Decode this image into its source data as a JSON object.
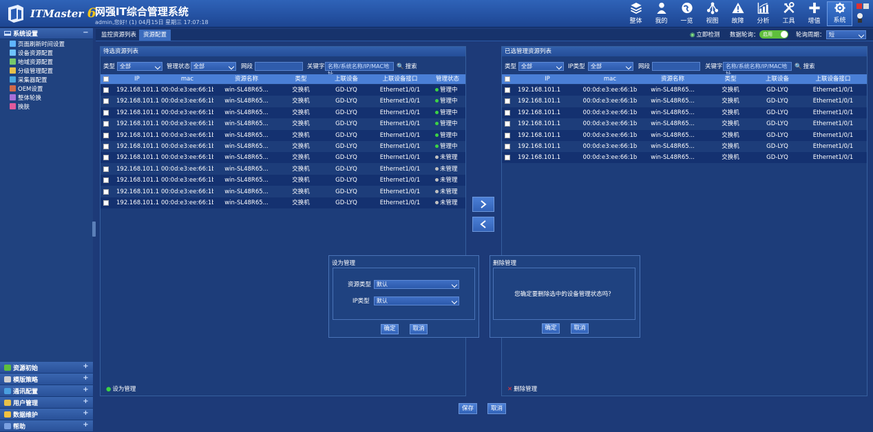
{
  "app": {
    "logo_text": "ITMaster",
    "logo_num": "6",
    "title": "网强IT综合管理系统",
    "subtitle": "admin,您好! (1) 04月15日 星期三 17:07:18"
  },
  "nav": [
    {
      "label": "整体",
      "icon": "layers-icon"
    },
    {
      "label": "我的",
      "icon": "user-icon"
    },
    {
      "label": "一览",
      "icon": "globe-icon"
    },
    {
      "label": "视图",
      "icon": "topology-icon"
    },
    {
      "label": "故障",
      "icon": "warning-icon"
    },
    {
      "label": "分析",
      "icon": "chart-icon"
    },
    {
      "label": "工具",
      "icon": "tools-icon"
    },
    {
      "label": "增值",
      "icon": "plus-icon"
    },
    {
      "label": "系统",
      "icon": "gear-icon"
    }
  ],
  "sidebar": {
    "section": "系统设置",
    "items": [
      "页面刷新时间设置",
      "设备资源配置",
      "地域资源配置",
      "分级管理配置",
      "采集器配置",
      "OEM设置",
      "整体轮换",
      "换肤"
    ],
    "bottom": [
      "资源初始",
      "模版策略",
      "通讯配置",
      "用户管理",
      "数据维护",
      "帮助"
    ]
  },
  "tabs": [
    "监控资源列表",
    "资源配置"
  ],
  "toolbar": {
    "detect": "立即检测",
    "polling_label": "数据轮询：",
    "polling_state": "启用",
    "cycle_label": "轮询周期：",
    "cycle_value": "短"
  },
  "left": {
    "title": "待选资源列表",
    "type_label": "类型",
    "type_value": "全部",
    "status_label": "管理状态",
    "status_value": "全部",
    "segment_label": "网段",
    "keyword_label": "关键字",
    "keyword_placeholder": "名称/系统名称/IP/MAC地址",
    "search": "搜索",
    "columns": [
      "IP",
      "mac",
      "资源名称",
      "类型",
      "上联设备",
      "上联设备接口",
      "管理状态"
    ],
    "rows": [
      {
        "ip": "192.168.101.1",
        "mac": "00:0d:e3:ee:66:1b",
        "name": "win-SL48R65...",
        "type": "交换机",
        "up": "GD-LYQ",
        "port": "Ethernet1/0/1",
        "status": "管理中",
        "managed": true
      },
      {
        "ip": "192.168.101.1",
        "mac": "00:0d:e3:ee:66:1b",
        "name": "win-SL48R65...",
        "type": "交换机",
        "up": "GD-LYQ",
        "port": "Ethernet1/0/1",
        "status": "管理中",
        "managed": true
      },
      {
        "ip": "192.168.101.1",
        "mac": "00:0d:e3:ee:66:1b",
        "name": "win-SL48R65...",
        "type": "交换机",
        "up": "GD-LYQ",
        "port": "Ethernet1/0/1",
        "status": "管理中",
        "managed": true
      },
      {
        "ip": "192.168.101.1",
        "mac": "00:0d:e3:ee:66:1b",
        "name": "win-SL48R65...",
        "type": "交换机",
        "up": "GD-LYQ",
        "port": "Ethernet1/0/1",
        "status": "管理中",
        "managed": true
      },
      {
        "ip": "192.168.101.1",
        "mac": "00:0d:e3:ee:66:1b",
        "name": "win-SL48R65...",
        "type": "交换机",
        "up": "GD-LYQ",
        "port": "Ethernet1/0/1",
        "status": "管理中",
        "managed": true
      },
      {
        "ip": "192.168.101.1",
        "mac": "00:0d:e3:ee:66:1b",
        "name": "win-SL48R65...",
        "type": "交换机",
        "up": "GD-LYQ",
        "port": "Ethernet1/0/1",
        "status": "管理中",
        "managed": true
      },
      {
        "ip": "192.168.101.1",
        "mac": "00:0d:e3:ee:66:1b",
        "name": "win-SL48R65...",
        "type": "交换机",
        "up": "GD-LYQ",
        "port": "Ethernet1/0/1",
        "status": "未管理",
        "managed": false
      },
      {
        "ip": "192.168.101.1",
        "mac": "00:0d:e3:ee:66:1b",
        "name": "win-SL48R65...",
        "type": "交换机",
        "up": "GD-LYQ",
        "port": "Ethernet1/0/1",
        "status": "未管理",
        "managed": false
      },
      {
        "ip": "192.168.101.1",
        "mac": "00:0d:e3:ee:66:1b",
        "name": "win-SL48R65...",
        "type": "交换机",
        "up": "GD-LYQ",
        "port": "Ethernet1/0/1",
        "status": "未管理",
        "managed": false
      },
      {
        "ip": "192.168.101.1",
        "mac": "00:0d:e3:ee:66:1b",
        "name": "win-SL48R65...",
        "type": "交换机",
        "up": "GD-LYQ",
        "port": "Ethernet1/0/1",
        "status": "未管理",
        "managed": false
      },
      {
        "ip": "192.168.101.1",
        "mac": "00:0d:e3:ee:66:1b",
        "name": "win-SL48R65...",
        "type": "交换机",
        "up": "GD-LYQ",
        "port": "Ethernet1/0/1",
        "status": "未管理",
        "managed": false
      }
    ],
    "footer_action": "设为管理"
  },
  "right": {
    "title": "已选管理资源列表",
    "type_label": "类型",
    "type_value": "全部",
    "iptype_label": "IP类型",
    "iptype_value": "全部",
    "segment_label": "网段",
    "keyword_label": "关键字",
    "keyword_placeholder": "名称/系统名称/IP/MAC地址",
    "search": "搜索",
    "columns": [
      "IP",
      "mac",
      "资源名称",
      "类型",
      "上联设备",
      "上联设备接口"
    ],
    "rows": [
      {
        "ip": "192.168.101.1",
        "mac": "00:0d:e3:ee:66:1b",
        "name": "win-SL48R65...",
        "type": "交换机",
        "up": "GD-LYQ",
        "port": "Ethernet1/0/1"
      },
      {
        "ip": "192.168.101.1",
        "mac": "00:0d:e3:ee:66:1b",
        "name": "win-SL48R65...",
        "type": "交换机",
        "up": "GD-LYQ",
        "port": "Ethernet1/0/1"
      },
      {
        "ip": "192.168.101.1",
        "mac": "00:0d:e3:ee:66:1b",
        "name": "win-SL48R65...",
        "type": "交换机",
        "up": "GD-LYQ",
        "port": "Ethernet1/0/1"
      },
      {
        "ip": "192.168.101.1",
        "mac": "00:0d:e3:ee:66:1b",
        "name": "win-SL48R65...",
        "type": "交换机",
        "up": "GD-LYQ",
        "port": "Ethernet1/0/1"
      },
      {
        "ip": "192.168.101.1",
        "mac": "00:0d:e3:ee:66:1b",
        "name": "win-SL48R65...",
        "type": "交换机",
        "up": "GD-LYQ",
        "port": "Ethernet1/0/1"
      },
      {
        "ip": "192.168.101.1",
        "mac": "00:0d:e3:ee:66:1b",
        "name": "win-SL48R65...",
        "type": "交换机",
        "up": "GD-LYQ",
        "port": "Ethernet1/0/1"
      },
      {
        "ip": "192.168.101.1",
        "mac": "00:0d:e3:ee:66:1b",
        "name": "win-SL48R65...",
        "type": "交换机",
        "up": "GD-LYQ",
        "port": "Ethernet1/0/1"
      }
    ],
    "footer_action": "删除管理"
  },
  "dialog_manage": {
    "title": "设为管理",
    "res_type_label": "资源类型",
    "res_type_value": "默认",
    "ip_type_label": "IP类型",
    "ip_type_value": "默认",
    "ok": "确定",
    "cancel": "取消"
  },
  "dialog_delete": {
    "title": "删除管理",
    "message": "您确定要删除选中的设备管理状态吗？",
    "ok": "确定",
    "cancel": "取消"
  },
  "bottom": {
    "save": "保存",
    "cancel": "取消"
  },
  "colors": {
    "accent": "#4a7fd6",
    "managed": "#3cd244",
    "unmanaged": "#c0c0c0",
    "toggle_on": "#5fbf3c"
  }
}
